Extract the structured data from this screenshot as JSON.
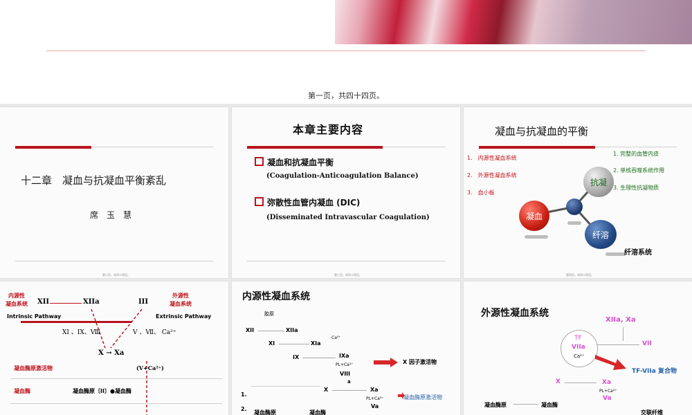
{
  "page_note": "第一页，共四十四页。",
  "slide1": {
    "chapter_title": "十二章　凝血与抗凝血平衡紊乱",
    "author": "席　玉　慧",
    "footer": "第二页，共四十四页。"
  },
  "slide2": {
    "title": "本章主要内容",
    "item1_cn": "凝血和抗凝血平衡",
    "item1_en": "(Coagulation-Anticoagulation Balance)",
    "item2_cn": "弥散性血管内凝血 (DIC)",
    "item2_en": "(Disseminated  Intravascular Coagulation)",
    "footer": "第三页，共四十四页。"
  },
  "slide3": {
    "title": "凝血与抗凝血的平衡",
    "left_items": [
      "1.　内源性凝血系统",
      "2.　外源性凝血系统",
      "3.　血小板"
    ],
    "right_items": [
      "1. 完整的血管内皮",
      "2. 单核吞噬系统作用",
      "3. 生理性抗凝物质"
    ],
    "ball_coag": "凝血",
    "ball_anti": "抗凝",
    "ball_fib": "纤溶",
    "fib_label": "纤溶系统",
    "footer": "第四页，共四十四页。"
  },
  "slide4": {
    "intrinsic": "内源性\n凝血系统",
    "extrinsic": "外源性\n凝血系统",
    "xii": "XII",
    "xiia": "XIIa",
    "iii": "III",
    "intrinsic_en": "Intrinsic Pathway",
    "extrinsic_en": "Extrinsic Pathway",
    "factors_left": "XI 、IX、Ⅷ",
    "factors_right": "V 、Ⅶ、 Ca²⁺",
    "x_to_xa": "X → Xa",
    "v_ca": "(V+Ca²⁺)",
    "activator": "凝血酶原激活物",
    "thrombin": "凝血酶",
    "prothrombin": "凝血酶原〔II〕●凝血酶"
  },
  "slide5": {
    "title": "内源性凝血系统",
    "collagen": "胶原",
    "xii": "XII",
    "xiia": "XIIa",
    "xi": "XI",
    "xia": "XIa",
    "ca": "Ca²⁺",
    "ix": "IX",
    "ixa": "IXa",
    "pl_ca": "PL+Ca²⁺",
    "viii": "VIII",
    "a": "a",
    "x_activator": "X 因子激活物",
    "x": "X",
    "xa": "Xa",
    "pl_ca2": "PL+Ca²⁺",
    "va": "Va",
    "activator": "凝血酶原激活物",
    "n1": "1.",
    "n2": "2.",
    "prothrombin": "凝血酶原",
    "thrombin": "凝血酶"
  },
  "slide6": {
    "title": "外源性凝血系统",
    "top": "XIIa, Xa",
    "tf": "TF",
    "viia": "VIIa",
    "ca": "Ca²⁺",
    "vii": "VII",
    "complex": "TF-VIIa 复合物",
    "x": "X",
    "xa": "Xa",
    "pl_ca": "PL+Ca²⁺",
    "va": "Va",
    "prothrombin": "凝血酶原",
    "thrombin": "凝血酶",
    "crosslink": "交联纤维"
  },
  "colors": {
    "accent_red": "#b7141f",
    "magenta": "#d84bd2",
    "blue": "#2a64a8",
    "green": "#1c6e1c"
  }
}
